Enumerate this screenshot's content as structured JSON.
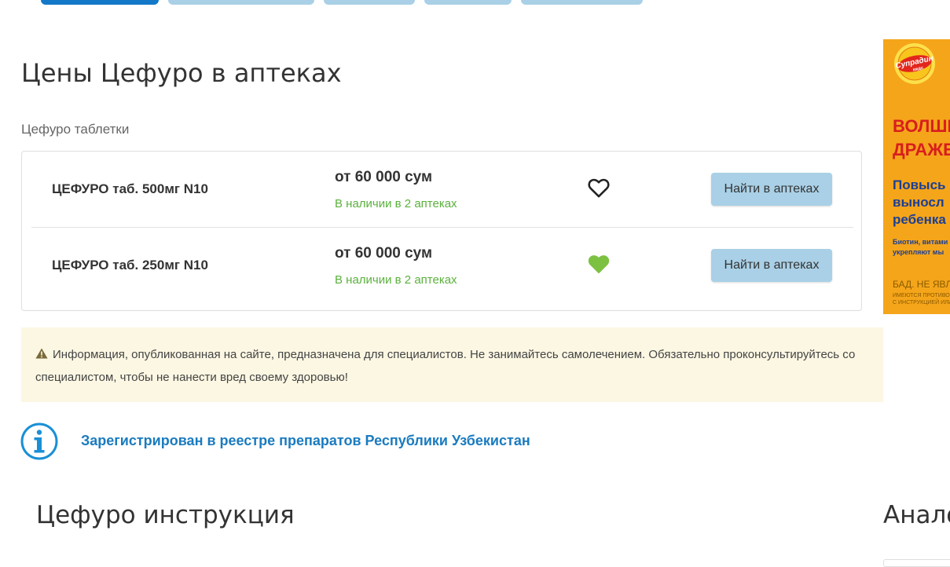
{
  "top_tabs": [
    {
      "state": "active"
    },
    {
      "state": "inactive"
    },
    {
      "state": "inactive"
    },
    {
      "state": "inactive"
    },
    {
      "state": "inactive"
    }
  ],
  "page_title": "Цены Цефуро в аптеках",
  "form_label": "Цефуро таблетки",
  "products": [
    {
      "name": "ЦЕФУРО таб. 500мг N10",
      "price": "от 60 000 сум",
      "availability": "В наличии в 2 аптеках",
      "favorite": false,
      "favorite_icon": "heart-outline-icon",
      "button_label": "Найти в аптеках"
    },
    {
      "name": "ЦЕФУРО таб. 250мг N10",
      "price": "от 60 000 сум",
      "availability": "В наличии в 2 аптеках",
      "favorite": true,
      "favorite_icon": "heart-filled-icon",
      "button_label": "Найти в аптеках"
    }
  ],
  "warning": {
    "icon": "warning-triangle-icon",
    "text": "Информация, опубликованная на сайте, предназначена для специалистов. Не занимайтесь самолечением. Обязательно проконсультируйтесь со специалистом, чтобы не нанести вред своему здоровью!"
  },
  "registry": {
    "icon": "info-circle-icon",
    "link_text": "Зарегистрирован в реестре препаратов Республики Узбекистан"
  },
  "instructions_title": "Цефуро инструкция",
  "sidebar_title": "Анало",
  "ad": {
    "logo_icon": "supradyn-kids-logo",
    "headline": "ВОЛШЕ\nДРАЖЕ",
    "subhead": "Повысь\nвыносл\nребенка",
    "small_text": "Биотин, витами\nукрепляют мы",
    "disclaimer": "БАД. НЕ ЯВЛЯЕТ",
    "fine_print": "ИМЕЮТСЯ ПРОТИВОПОКА\nС ИНСТРУКЦИЕЙ ИЛИ ПРО"
  },
  "colors": {
    "accent_blue": "#1478c8",
    "button_bg": "#a9d0e6",
    "stock_green": "#5ab13c",
    "heart_green": "#7dc142",
    "warning_bg": "#fcf7e3",
    "link_blue": "#1a7bbf",
    "ad_orange": "#f5a51a"
  }
}
